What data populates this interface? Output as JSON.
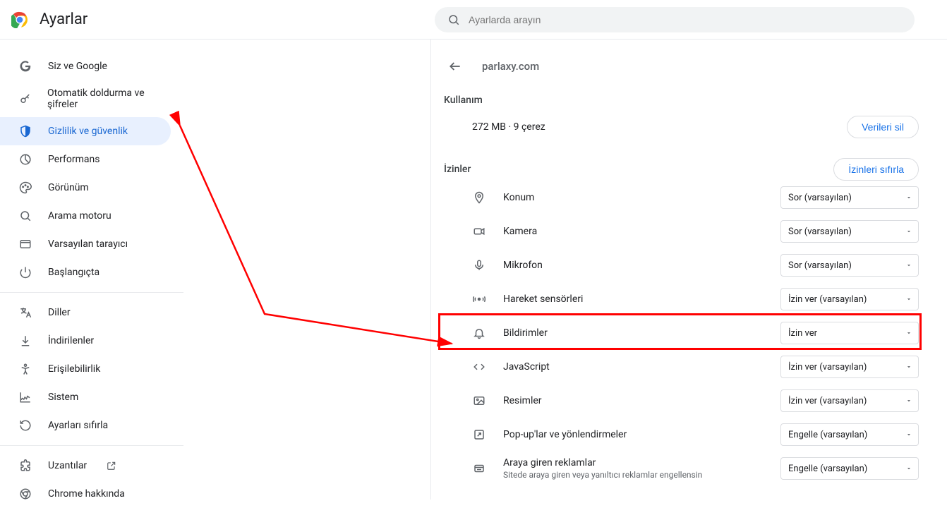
{
  "header": {
    "title": "Ayarlar",
    "search_placeholder": "Ayarlarda arayın"
  },
  "sidebar": {
    "groups": [
      [
        {
          "icon": "google",
          "label": "Siz ve Google"
        },
        {
          "icon": "key",
          "label": "Otomatik doldurma ve şifreler"
        },
        {
          "icon": "shield",
          "label": "Gizlilik ve güvenlik",
          "active": true
        },
        {
          "icon": "speed",
          "label": "Performans"
        },
        {
          "icon": "palette",
          "label": "Görünüm"
        },
        {
          "icon": "search",
          "label": "Arama motoru"
        },
        {
          "icon": "browser",
          "label": "Varsayılan tarayıcı"
        },
        {
          "icon": "power",
          "label": "Başlangıçta"
        }
      ],
      [
        {
          "icon": "translate",
          "label": "Diller"
        },
        {
          "icon": "download",
          "label": "İndirilenler"
        },
        {
          "icon": "accessibility",
          "label": "Erişilebilirlik"
        },
        {
          "icon": "system",
          "label": "Sistem"
        },
        {
          "icon": "reset",
          "label": "Ayarları sıfırla"
        }
      ],
      [
        {
          "icon": "extension",
          "label": "Uzantılar",
          "ext": true
        },
        {
          "icon": "chrome",
          "label": "Chrome hakkında"
        }
      ]
    ]
  },
  "main": {
    "site": "parlaxy.com",
    "usage_title": "Kullanım",
    "usage_value": "272 MB · 9 çerez",
    "clear_data": "Verileri sil",
    "permissions_title": "İzinler",
    "reset_permissions": "İzinleri sıfırla",
    "permissions": [
      {
        "icon": "location",
        "label": "Konum",
        "value": "Sor (varsayılan)"
      },
      {
        "icon": "camera",
        "label": "Kamera",
        "value": "Sor (varsayılan)"
      },
      {
        "icon": "mic",
        "label": "Mikrofon",
        "value": "Sor (varsayılan)"
      },
      {
        "icon": "motion",
        "label": "Hareket sensörleri",
        "value": "İzin ver (varsayılan)"
      },
      {
        "icon": "bell",
        "label": "Bildirimler",
        "value": "İzin ver",
        "highlight": true
      },
      {
        "icon": "code",
        "label": "JavaScript",
        "value": "İzin ver (varsayılan)"
      },
      {
        "icon": "image",
        "label": "Resimler",
        "value": "İzin ver (varsayılan)"
      },
      {
        "icon": "popup",
        "label": "Pop-up'lar ve yönlendirmeler",
        "value": "Engelle (varsayılan)"
      },
      {
        "icon": "ads",
        "label": "Araya giren reklamlar",
        "sub": "Sitede araya giren veya yanıltıcı reklamlar engellensin",
        "value": "Engelle (varsayılan)"
      }
    ]
  },
  "colors": {
    "accent": "#1a73e8",
    "red": "#ff0000"
  }
}
